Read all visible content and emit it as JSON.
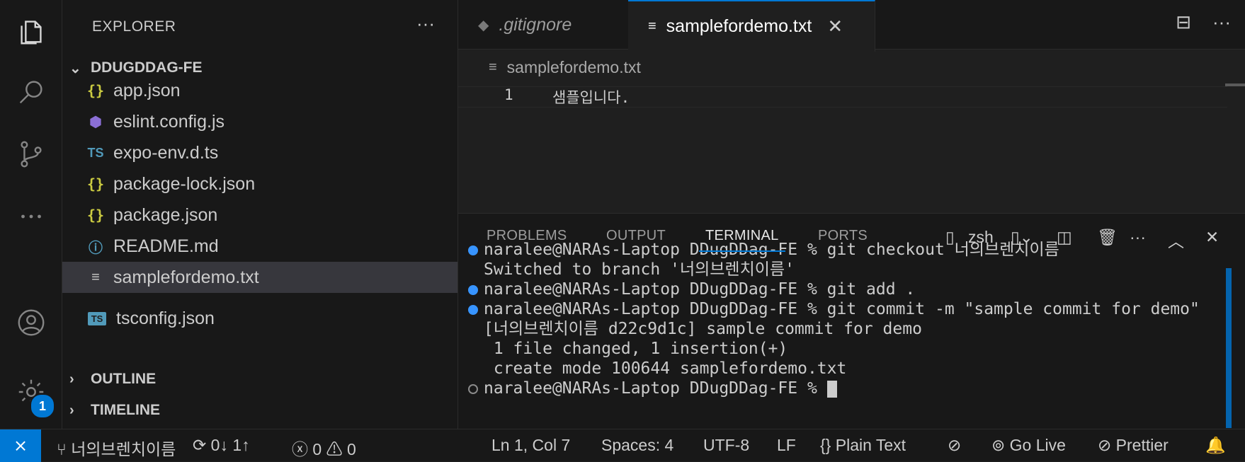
{
  "sidebar": {
    "title": "EXPLORER",
    "project": "DDUGDDAG-FE",
    "files": [
      {
        "name": "app.json",
        "icon": "json-icon",
        "glyph": "{}"
      },
      {
        "name": "eslint.config.js",
        "icon": "eslint-icon",
        "glyph": "⬢"
      },
      {
        "name": "expo-env.d.ts",
        "icon": "ts-icon",
        "glyph": "TS"
      },
      {
        "name": "package-lock.json",
        "icon": "json-icon",
        "glyph": "{}"
      },
      {
        "name": "package.json",
        "icon": "json-icon",
        "glyph": "{}"
      },
      {
        "name": "README.md",
        "icon": "info-icon",
        "glyph": "ⓘ"
      },
      {
        "name": "samplefordemo.txt",
        "icon": "text-file-icon",
        "glyph": "≡"
      },
      {
        "name": "tsconfig.json",
        "icon": "ts-config-icon",
        "glyph": "TS"
      }
    ],
    "selected_index": 6,
    "outline": "OUTLINE",
    "timeline": "TIMELINE"
  },
  "activity": {
    "settings_badge": "1"
  },
  "tabs": [
    {
      "label": ".gitignore",
      "active": false
    },
    {
      "label": "samplefordemo.txt",
      "active": true
    }
  ],
  "editor": {
    "breadcrumb": "samplefordemo.txt",
    "lines": [
      {
        "num": "1",
        "text": "샘플입니다."
      }
    ]
  },
  "panel": {
    "tabs": [
      "PROBLEMS",
      "OUTPUT",
      "TERMINAL",
      "PORTS"
    ],
    "active_tab": "TERMINAL",
    "shell": "zsh",
    "terminal": [
      "naralee@NARAs-Laptop DDugDDag-FE % git checkout 너의브렌치이름",
      "Switched to branch '너의브렌치이름'",
      "naralee@NARAs-Laptop DDugDDag-FE % git add .",
      "naralee@NARAs-Laptop DDugDDag-FE % git commit -m \"sample commit for demo\"",
      "[너의브렌치이름 d22c9d1c] sample commit for demo",
      " 1 file changed, 1 insertion(+)",
      " create mode 100644 samplefordemo.txt",
      "naralee@NARAs-Laptop DDugDDag-FE % "
    ]
  },
  "status": {
    "branch": "너의브렌치이름",
    "sync": "0↓ 1↑",
    "errors": "0",
    "warnings": "0",
    "position": "Ln 1, Col 7",
    "spaces": "Spaces: 4",
    "encoding": "UTF-8",
    "eol": "LF",
    "language": "Plain Text",
    "golive": "Go Live",
    "prettier": "Prettier"
  },
  "colors": {
    "accent": "#0078d4",
    "background": "#1f1f1f",
    "sidebar": "#181818"
  }
}
